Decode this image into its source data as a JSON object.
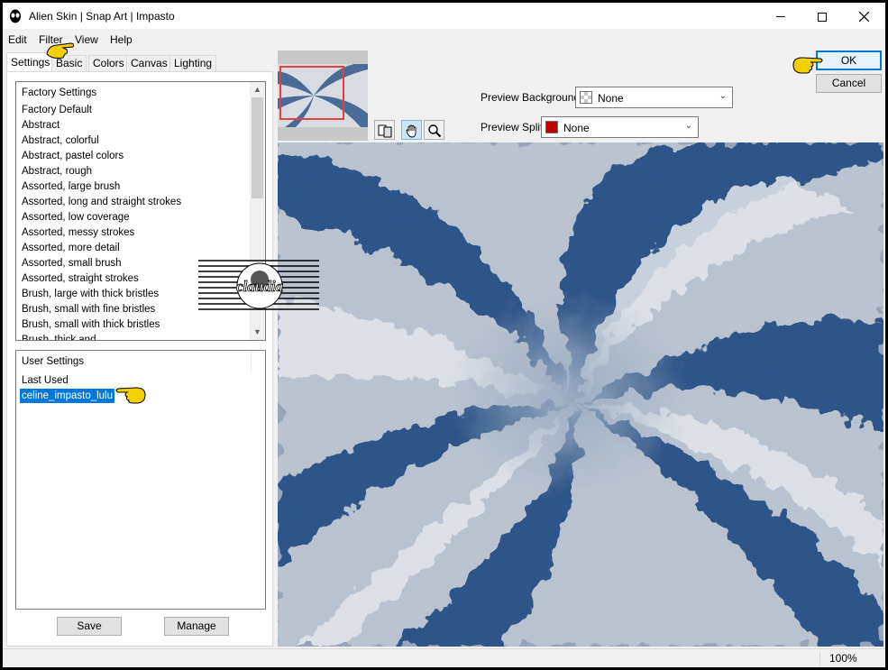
{
  "window": {
    "title": "Alien Skin | Snap Art | Impasto"
  },
  "menu": [
    "Edit",
    "Filter",
    "View",
    "Help"
  ],
  "tabs": [
    "Settings",
    "Basic",
    "Colors",
    "Canvas",
    "Lighting"
  ],
  "factory_settings": {
    "header": "Factory Settings",
    "items": [
      "Factory Default",
      "Abstract",
      "Abstract, colorful",
      "Abstract, pastel colors",
      "Abstract, rough",
      "Assorted, large brush",
      "Assorted, long and straight strokes",
      "Assorted, low coverage",
      "Assorted, messy strokes",
      "Assorted, more detail",
      "Assorted, small brush",
      "Assorted, straight strokes",
      "Brush, large with thick bristles",
      "Brush, small with fine bristles",
      "Brush, small with thick bristles",
      "Brush, thick and"
    ]
  },
  "user_settings": {
    "header": "User Settings",
    "items": [
      "Last Used"
    ],
    "selected": "celine_impasto_lulu"
  },
  "buttons": {
    "save": "Save",
    "manage": "Manage",
    "ok": "OK",
    "cancel": "Cancel"
  },
  "preview_background": {
    "label": "Preview Background:",
    "value": "None"
  },
  "preview_split": {
    "label": "Preview Split:",
    "value": "None",
    "color": "#c00000"
  },
  "status": {
    "zoom": "100%"
  },
  "watermark": {
    "text": "claudia"
  },
  "colors": {
    "selection": "#0078d7",
    "preview_dark": "#2f5585",
    "preview_light": "#d9dde3"
  }
}
